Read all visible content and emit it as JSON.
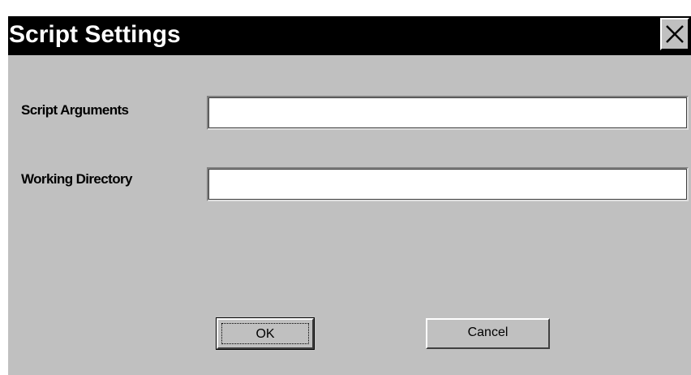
{
  "dialog": {
    "title": "Script Settings",
    "close_icon": "close-icon",
    "fields": {
      "script_arguments": {
        "label": "Script Arguments",
        "value": ""
      },
      "working_directory": {
        "label": "Working Directory",
        "value": ""
      }
    },
    "buttons": {
      "ok_label": "OK",
      "cancel_label": "Cancel"
    }
  },
  "colors": {
    "dialog_background": "#c0c0c0",
    "titlebar_background": "#000000",
    "title_text": "#ffffff"
  }
}
